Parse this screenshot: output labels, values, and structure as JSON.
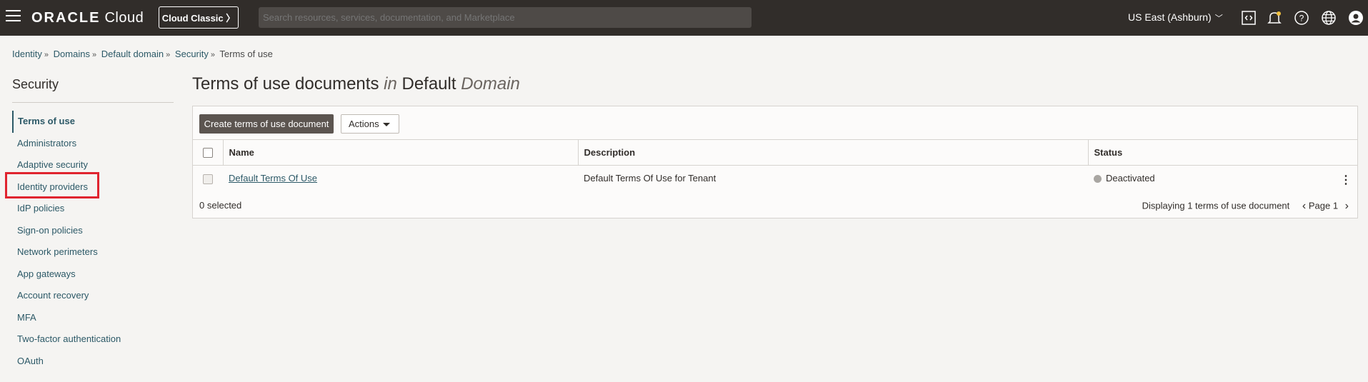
{
  "topbar": {
    "logo_oracle": "ORACLE",
    "logo_cloud": "Cloud",
    "cloud_classic": "Cloud Classic",
    "search_placeholder": "Search resources, services, documentation, and Marketplace",
    "region": "US East (Ashburn)"
  },
  "breadcrumb": {
    "items": [
      "Identity",
      "Domains",
      "Default domain",
      "Security"
    ],
    "current": "Terms of use"
  },
  "sidebar": {
    "title": "Security",
    "items": [
      {
        "label": "Terms of use",
        "active": true
      },
      {
        "label": "Administrators"
      },
      {
        "label": "Adaptive security"
      },
      {
        "label": "Identity providers"
      },
      {
        "label": "IdP policies"
      },
      {
        "label": "Sign-on policies"
      },
      {
        "label": "Network perimeters"
      },
      {
        "label": "App gateways"
      },
      {
        "label": "Account recovery"
      },
      {
        "label": "MFA"
      },
      {
        "label": "Two-factor authentication"
      },
      {
        "label": "OAuth"
      }
    ]
  },
  "main": {
    "title_part1": "Terms of use documents",
    "title_in": "in",
    "title_part2": "Default",
    "title_domain": "Domain",
    "create_button": "Create terms of use document",
    "actions_button": "Actions",
    "columns": [
      "Name",
      "Description",
      "Status"
    ],
    "rows": [
      {
        "name": "Default Terms Of Use",
        "description": "Default Terms Of Use for Tenant",
        "status": "Deactivated"
      }
    ],
    "selected_text": "0 selected",
    "displaying_text": "Displaying 1 terms of use document",
    "page_text": "Page 1"
  },
  "colors": {
    "topbar": "#312d2a",
    "link": "#2c5967",
    "highlight": "#e0242f"
  }
}
